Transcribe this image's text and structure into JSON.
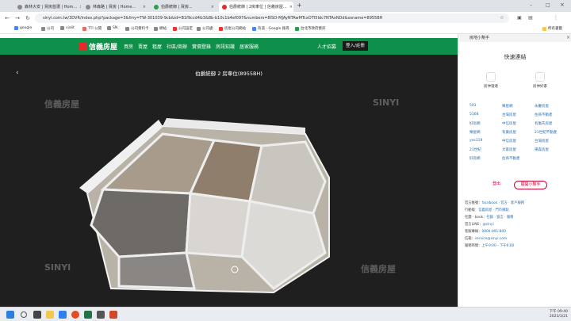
{
  "browser": {
    "tabs": [
      {
        "label": "森林大安 | 買房首選 | Hom...",
        "active": false
      },
      {
        "label": "林森路 | 買房 | Home...",
        "active": false
      },
      {
        "label": "伯爵統御 | 買房...",
        "active": false
      },
      {
        "label": "伯爵統御 | 2房車位 | 信義房屋...",
        "active": true
      }
    ],
    "new_tab": "+",
    "url": "sinyi.com.tw/3DVR/index.php?package=3&fmy=TW-301039-9cb&id=B1f9ccd4&3&8b-b10c1b4ef097&numbers=8ISO-MJAyNTAwMTcxOTI5Idc7NTAxNDd&osname=8955BH",
    "bookmarks": [
      "google",
      "公司",
      "vialit",
      "TTI 公開",
      "SN",
      "公司資料卡",
      "網站",
      "公司設定",
      "公司處",
      "房屋公司網站",
      "有道 - Google 搜尋",
      "台北市政府資訊"
    ],
    "bookmarks_right": "所有書籤"
  },
  "site": {
    "logo": "信義房屋",
    "nav": [
      "買房",
      "賣屋",
      "租屋",
      "社區/商辦",
      "實價登錄",
      "房訊知識",
      "居家服務"
    ],
    "recruit": "人才招募",
    "login": "登入/註冊"
  },
  "viewer": {
    "title": "伯爵統御 2 房車位(8955BH)",
    "watermark_logo": "信義房屋",
    "watermark_sinyi": "SINYI"
  },
  "panel": {
    "head": "房地小幫手",
    "quick_title": "快速連結",
    "quick_icons": [
      "房仲發達",
      "房仲好家"
    ],
    "links": [
      [
        "591",
        "樂屋網",
        "永慶房屋"
      ],
      [
        "5168",
        "台灣房屋",
        "住商不動產"
      ],
      [
        "好房網",
        "中信房屋",
        "有巢氏房屋"
      ],
      [
        "樂屋網",
        "有巢房屋",
        "21世紀不動產"
      ],
      [
        "yes319",
        "中信房屋",
        "台灣房屋"
      ],
      [
        "21世紀",
        "大家房屋",
        "東森房屋"
      ],
      [
        "好房網",
        "住商不動產",
        ""
      ]
    ],
    "logout": "登出",
    "open": "展開小幫手",
    "info": [
      {
        "label": "官方帳號：",
        "value": "facebook · 官方 · 客戶服務"
      },
      {
        "label": "行動版：",
        "value": "信義房屋 · 門市據點"
      },
      {
        "label": "社團 ⋅ book：",
        "value": "社群 · 留言 · 服務"
      },
      {
        "label": "官方LINE：",
        "value": "@sinyi"
      },
      {
        "label": "客服專線：",
        "value": "0800-091-800"
      },
      {
        "label": "信箱：",
        "value": "service@sinyi.com"
      },
      {
        "label": "服務時間：",
        "value": "上午9:00 - 下午6:00"
      }
    ]
  },
  "taskbar": {
    "time": "下午 09:40",
    "date": "2023/3/21"
  }
}
